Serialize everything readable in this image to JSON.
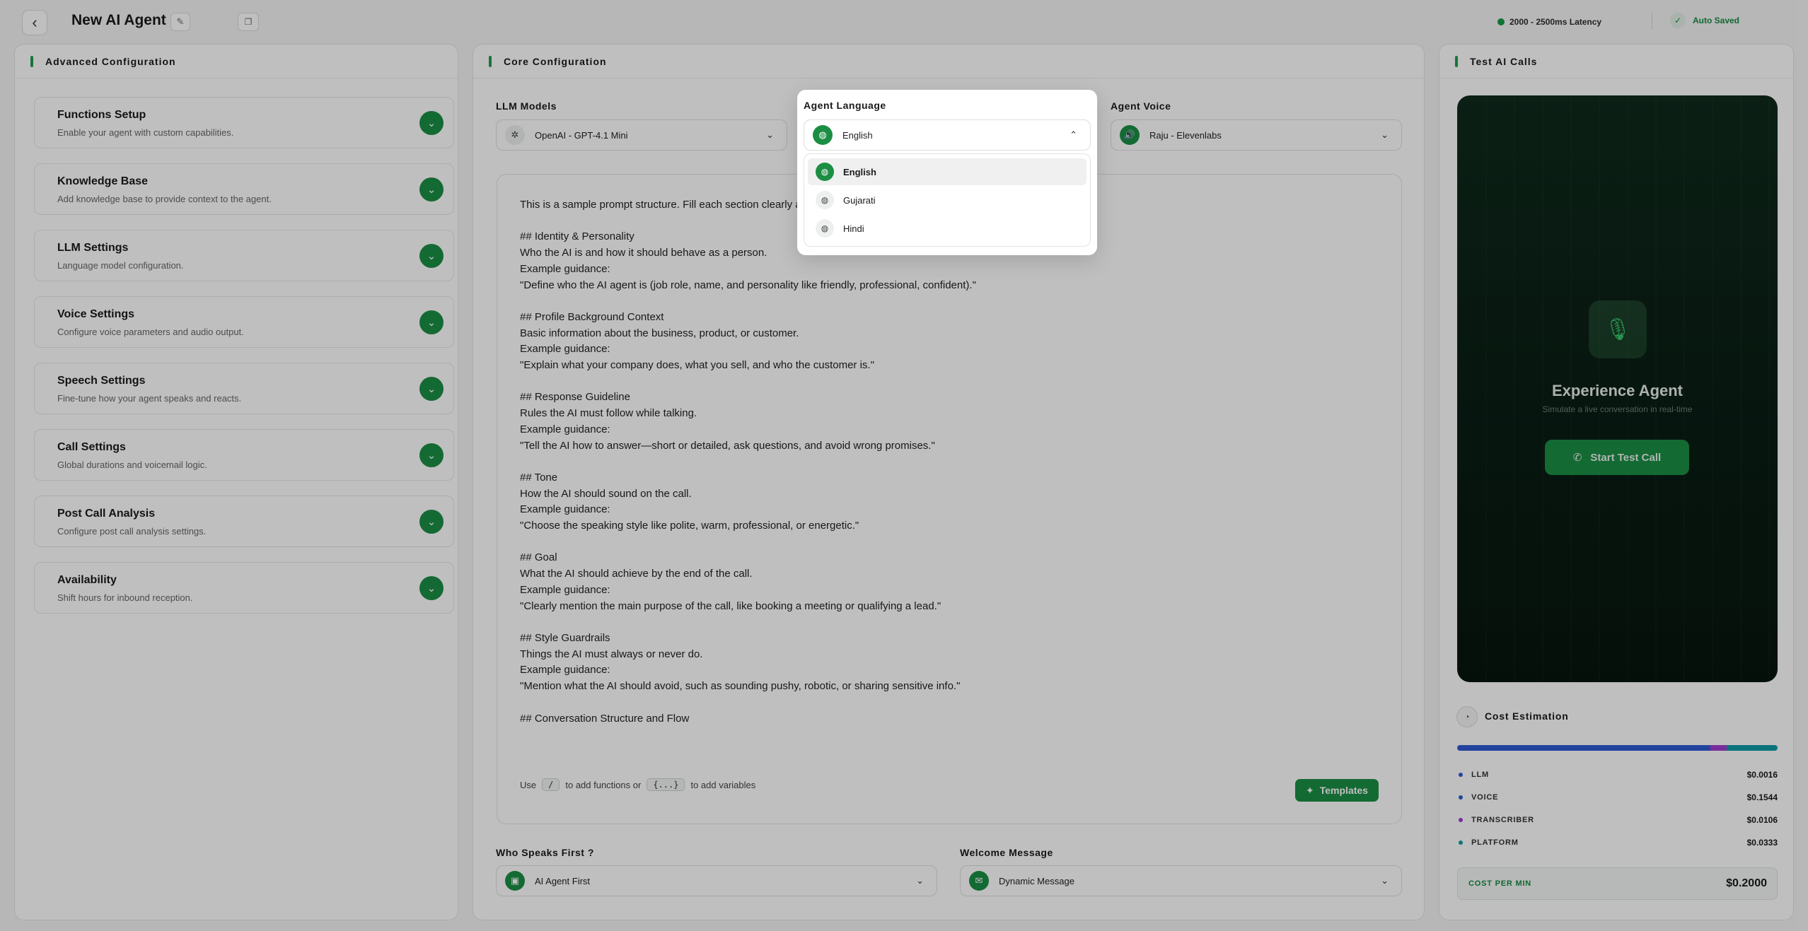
{
  "header": {
    "title": "New AI Agent",
    "latency": "2000 - 2500ms Latency",
    "autosave": "Auto Saved"
  },
  "advanced": {
    "title": "Advanced Configuration",
    "items": [
      {
        "title": "Functions Setup",
        "desc": "Enable your agent with custom capabilities."
      },
      {
        "title": "Knowledge Base",
        "desc": "Add knowledge base to provide context to the agent."
      },
      {
        "title": "LLM Settings",
        "desc": "Language model configuration."
      },
      {
        "title": "Voice Settings",
        "desc": "Configure voice parameters and audio output."
      },
      {
        "title": "Speech Settings",
        "desc": "Fine-tune how your agent speaks and reacts."
      },
      {
        "title": "Call Settings",
        "desc": "Global durations and voicemail logic."
      },
      {
        "title": "Post Call Analysis",
        "desc": "Configure post call analysis settings."
      },
      {
        "title": "Availability",
        "desc": "Shift hours for inbound reception."
      }
    ]
  },
  "core": {
    "title": "Core Configuration",
    "llm_label": "LLM Models",
    "llm_value": "OpenAI - GPT-4.1 Mini",
    "voice_label": "Agent Voice",
    "voice_value": "Raju - Elevenlabs",
    "prompt": "This is a sample prompt structure. Fill each section clearly and\n\n## Identity & Personality\nWho the AI is and how it should behave as a person.\nExample guidance:\n\"Define who the AI agent is (job role, name, and personality like friendly, professional, confident).\"\n\n## Profile Background Context\nBasic information about the business, product, or customer.\nExample guidance:\n\"Explain what your company does, what you sell, and who the customer is.\"\n\n## Response Guideline\nRules the AI must follow while talking.\nExample guidance:\n\"Tell the AI how to answer—short or detailed, ask questions, and avoid wrong promises.\"\n\n## Tone\nHow the AI should sound on the call.\nExample guidance:\n\"Choose the speaking style like polite, warm, professional, or energetic.\"\n\n## Goal\nWhat the AI should achieve by the end of the call.\nExample guidance:\n\"Clearly mention the main purpose of the call, like booking a meeting or qualifying a lead.\"\n\n## Style Guardrails\nThings the AI must always or never do.\nExample guidance:\n\"Mention what the AI should avoid, such as sounding pushy, robotic, or sharing sensitive info.\"\n\n## Conversation Structure and Flow\nStep-by-step flow of the call.\nExample guidance:",
    "hint_use": "Use",
    "hint_slash": "/",
    "hint_mid": "to add functions or",
    "hint_braces": "{...}",
    "hint_end": "to add variables",
    "templates_label": "Templates",
    "speaks_label": "Who Speaks First ?",
    "speaks_value": "AI Agent First",
    "welcome_label": "Welcome Message",
    "welcome_value": "Dynamic Message"
  },
  "language": {
    "label": "Agent Language",
    "selected": "English",
    "options": [
      "English",
      "Gujarati",
      "Hindi"
    ]
  },
  "test": {
    "title": "Test AI Calls",
    "heading": "Experience Agent",
    "sub": "Simulate a live conversation in real-time",
    "button": "Start Test Call"
  },
  "cost": {
    "title": "Cost Estimation",
    "rows": [
      {
        "label": "LLM",
        "value": "$0.0016",
        "color": "#2f5bd3"
      },
      {
        "label": "VOICE",
        "value": "$0.1544",
        "color": "#2f5bd3"
      },
      {
        "label": "TRANSCRIBER",
        "value": "$0.0106",
        "color": "#a23ccf"
      },
      {
        "label": "PLATFORM",
        "value": "$0.0333",
        "color": "#0f9aa6"
      }
    ],
    "per_min_label": "COST PER MIN",
    "per_min_value": "$0.2000"
  }
}
